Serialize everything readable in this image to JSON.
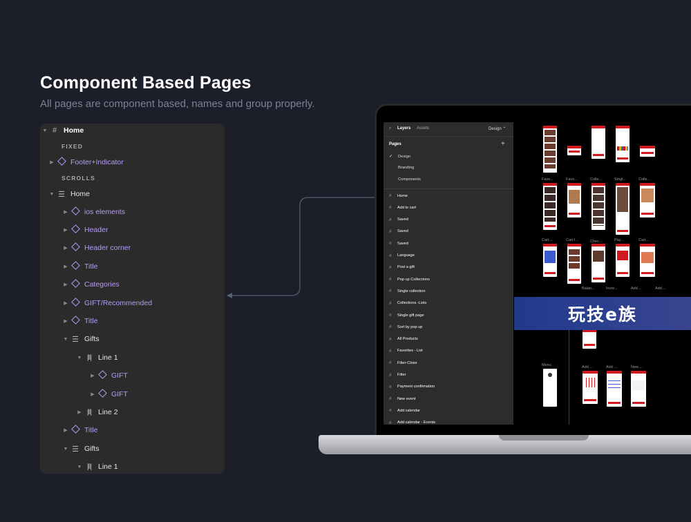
{
  "heading": "Component Based Pages",
  "subheading": "All pages are component based,  names and group properly.",
  "layers": {
    "root_label": "Home",
    "fixed_label": "FIXED",
    "footer_label": "Footer+Indicator",
    "scrolls_label": "SCROLLS",
    "home_label": "Home",
    "items": [
      "ios elements",
      "Header",
      "Header corner",
      "Title",
      "Categories",
      "GIFT/Recommended",
      "Title"
    ],
    "gifts_label": "Gifts",
    "line1_label": "Line 1",
    "gift_labels": [
      "GIFT",
      "GIFT"
    ],
    "line2_label": "Line 2",
    "title2_label": "Title",
    "gifts2_label": "Gifts",
    "line1b_label": "Line 1"
  },
  "figma": {
    "tab_layers": "Layers",
    "tab_assets": "Assets",
    "mode": "Design ⌃",
    "pages_label": "Pages",
    "add": "+",
    "pages": [
      "Design",
      "Branding",
      "Components"
    ],
    "frames": [
      "Home",
      "Add to cart",
      "Saved",
      "Saved",
      "Saved",
      "Language",
      "Post a gift",
      "Pop up Collecrions",
      "Single collection",
      "Collections -Lists",
      "Single gift page",
      "Sort by pop up",
      "All Products",
      "Favorites - List",
      "Filter-Close",
      "Filter",
      "Payment confirmation",
      "New event",
      "Add calendar",
      "Add calendar - Events"
    ]
  },
  "canvas": {
    "row2_labels": [
      "Favo...",
      "Favo...",
      "Colle...",
      "Singl...",
      "Colle..."
    ],
    "row3_labels": [
      "Cart...",
      "Cart I...",
      "Chec...",
      "Pay...",
      "Cart..."
    ],
    "row4_labels": [
      "Balan...",
      "Incre...",
      "Add ...",
      "Add ..."
    ],
    "row5_labels": [
      "Menu",
      "Add ...",
      "Add ...",
      "New ..."
    ]
  },
  "watermark": "玩技e族",
  "colors": {
    "accent": "#d0191f",
    "purple": "#b59cf7",
    "background": "#1c1e29"
  }
}
